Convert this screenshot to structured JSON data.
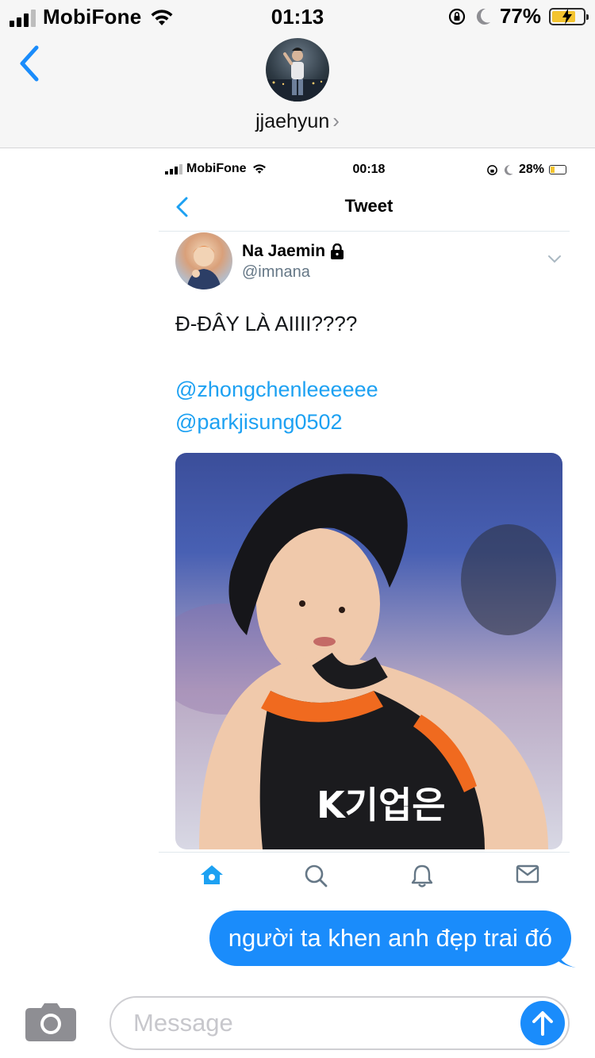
{
  "status_bar": {
    "carrier": "MobiFone",
    "time": "01:13",
    "battery_percent": "77%",
    "battery_level": 0.77,
    "icons": [
      "signal-icon",
      "wifi-icon",
      "orientation-lock-icon",
      "moon-icon",
      "battery-charging-icon"
    ]
  },
  "conversation": {
    "contact_name": "jjaehyun",
    "back_icon": "chevron-left-icon",
    "accent_color": "#1a8cfb"
  },
  "tweet_screenshot": {
    "status_bar": {
      "carrier": "MobiFone",
      "time": "00:18",
      "battery_percent": "28%",
      "battery_level": 0.28
    },
    "nav_title": "Tweet",
    "author": {
      "name": "Na Jaemin",
      "handle": "@imnana",
      "locked": true
    },
    "text": "Đ-ĐÂY LÀ AIIII????",
    "mentions": [
      "@zhongchenleeeeee",
      "@parkjisung0502"
    ],
    "mention_color": "#1da1f2",
    "tabs": [
      "home-icon",
      "search-icon",
      "notifications-icon",
      "messages-icon"
    ]
  },
  "messages": [
    {
      "direction": "outgoing",
      "text": "người ta khen anh đẹp trai đó"
    }
  ],
  "composer": {
    "placeholder": "Message"
  }
}
